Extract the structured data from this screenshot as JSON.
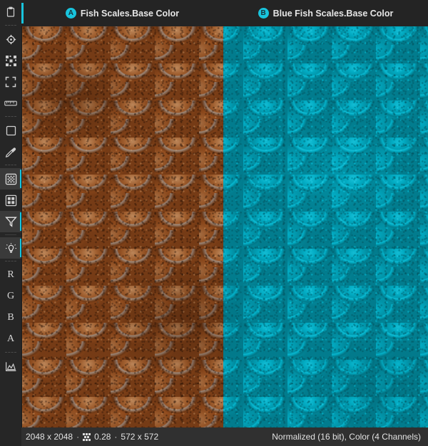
{
  "app": {
    "accent_color": "#18c4dd",
    "background_color": "#1c1c1c",
    "sidebar_color": "#262626",
    "statusbar_color": "#303030"
  },
  "sidebar": {
    "items": [
      {
        "name": "clipboard-icon",
        "label": "Copy",
        "icon": "clipboard",
        "active": false,
        "type": "icon"
      },
      {
        "name": "target-icon",
        "label": "Pick Target",
        "icon": "target",
        "active": false,
        "type": "icon"
      },
      {
        "name": "scatter-icon",
        "label": "Scatter",
        "icon": "scatter",
        "active": false,
        "type": "icon"
      },
      {
        "name": "fit-icon",
        "label": "Fit To Screen",
        "icon": "fit",
        "active": false,
        "type": "icon"
      },
      {
        "name": "ruler-icon",
        "label": "Measure",
        "icon": "ruler",
        "active": false,
        "type": "icon"
      },
      {
        "name": "square-icon",
        "label": "Select Region",
        "icon": "square",
        "active": false,
        "type": "icon"
      },
      {
        "name": "eyedropper-icon",
        "label": "Color Picker",
        "icon": "eyedropper",
        "active": false,
        "type": "icon"
      },
      {
        "name": "pixel-grid-icon",
        "label": "Pixel Grid",
        "icon": "pixelgrid",
        "active": true,
        "type": "icon"
      },
      {
        "name": "tile-grid-icon",
        "label": "Tiling",
        "icon": "tilegrid",
        "active": false,
        "type": "icon"
      },
      {
        "name": "filter-icon",
        "label": "Filtering",
        "icon": "filter",
        "active": true,
        "type": "icon"
      },
      {
        "name": "brightness-icon",
        "label": "Exposure",
        "icon": "brightness",
        "active": true,
        "type": "icon"
      },
      {
        "name": "channel-button-r",
        "label": "R",
        "icon": "",
        "active": false,
        "type": "letter"
      },
      {
        "name": "channel-button-g",
        "label": "G",
        "icon": "",
        "active": false,
        "type": "letter"
      },
      {
        "name": "channel-button-b",
        "label": "B",
        "icon": "",
        "active": false,
        "type": "letter"
      },
      {
        "name": "channel-button-a",
        "label": "A",
        "icon": "",
        "active": false,
        "type": "letter"
      },
      {
        "name": "histogram-icon",
        "label": "Histogram",
        "icon": "histogram",
        "active": false,
        "type": "icon"
      }
    ]
  },
  "header": {
    "panes": [
      {
        "badge": "A",
        "title": "Fish Scales.Base Color"
      },
      {
        "badge": "B",
        "title": "Blue Fish Scales.Base Color"
      }
    ]
  },
  "viewport": {
    "pane_a": {
      "badge": "A",
      "texture": "fish-scales-orange"
    },
    "pane_b": {
      "badge": "B",
      "texture": "fish-scales-blue"
    }
  },
  "statusbar": {
    "resolution": "2048 x 2048",
    "separator": "·",
    "zoom_icon": "zoom-pixel-icon",
    "zoom": "0.28",
    "display_size": "572 x 572",
    "format": "Normalized (16 bit), Color (4 Channels)"
  }
}
